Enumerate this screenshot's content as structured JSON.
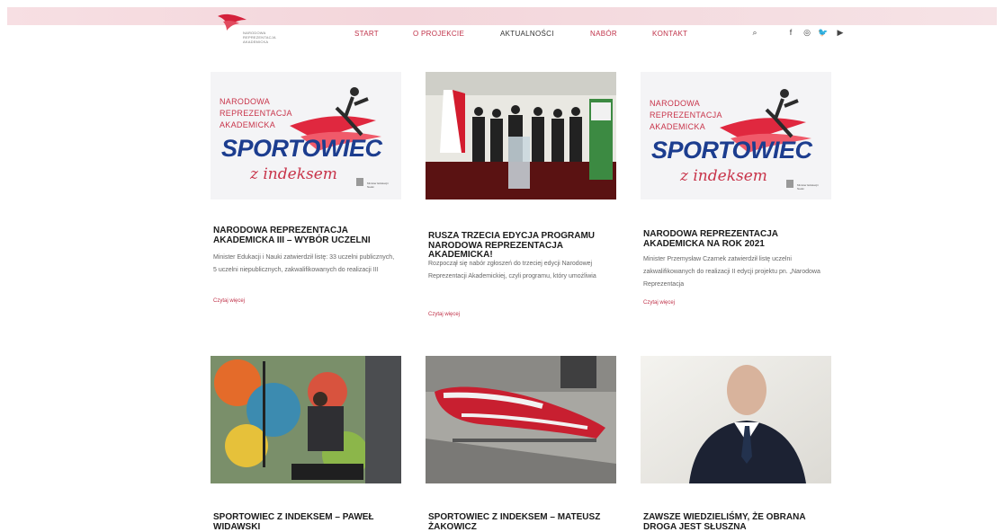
{
  "header": {
    "logo_text": "NARODOWA REPREZENTACJA AKADEMICKA",
    "nav": [
      {
        "label": "START",
        "active": false
      },
      {
        "label": "O PROJEKCIE",
        "active": false
      },
      {
        "label": "AKTUALNOŚCI",
        "active": true
      },
      {
        "label": "NABÓR",
        "active": false
      },
      {
        "label": "KONTAKT",
        "active": false
      }
    ],
    "tools": [
      "search-icon",
      "facebook-icon",
      "instagram-icon",
      "twitter-icon",
      "youtube-icon"
    ],
    "tool_glyphs": [
      "⌕",
      "f",
      "◎",
      "🐦",
      "▶"
    ]
  },
  "promo": {
    "line1": "NARODOWA",
    "line2": "REPREZENTACJA",
    "line3": "AKADEMICKA",
    "big": "SPORTOWIEC",
    "script": "z indeksem",
    "ministry": "Minister Edukacji i Nauki"
  },
  "cards": [
    {
      "image": "promo",
      "title": "NARODOWA REPREZENTACJA AKADEMICKA III – WYBÓR UCZELNI",
      "excerpt": "Minister Edukacji i Nauki zatwierdził listę: 33 uczelni publicznych, 5 uczelni niepublicznych, zakwalifikowanych do realizacji III",
      "more": "Czytaj więcej"
    },
    {
      "image": "press",
      "title": "RUSZA TRZECIA EDYCJA PROGRAMU NARODOWA REPREZENTACJA AKADEMICKA!",
      "excerpt": "Rozpoczął się nabór zgłoszeń do trzeciej edycji Narodowej Reprezentacji Akademickiej, czyli programu, który umożliwia",
      "more": "Czytaj więcej"
    },
    {
      "image": "promo",
      "title": "NARODOWA REPREZENTACJA AKADEMICKA NA ROK 2021",
      "excerpt": "Minister Przemysław Czarnek zatwierdził listę uczelni zakwalifikowanych do realizacji II edycji projektu pn. „Narodowa Reprezentacja",
      "more": "Czytaj więcej"
    },
    {
      "image": "mural",
      "title": "SPORTOWIEC Z INDEKSEM – PAWEŁ WIDAWSKI",
      "excerpt": "",
      "more": ""
    },
    {
      "image": "sled",
      "title": "SPORTOWIEC Z INDEKSEM – MATEUSZ ŻAKOWICZ",
      "excerpt": "",
      "more": ""
    },
    {
      "image": "man",
      "title": "ZAWSZE WIEDZIELIŚMY, ŻE OBRANA DROGA JEST SŁUSZNA",
      "excerpt": "",
      "more": ""
    }
  ],
  "colors": {
    "accent": "#c0334a",
    "navy": "#1c3d8f",
    "text": "#1b1b1b"
  }
}
